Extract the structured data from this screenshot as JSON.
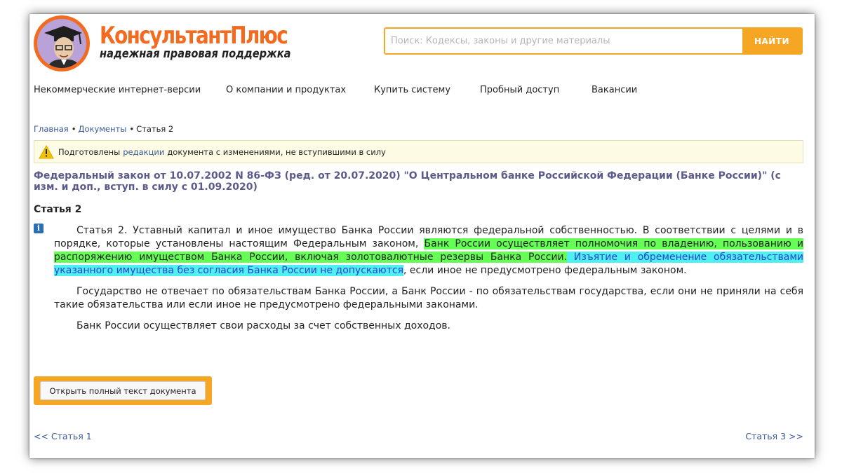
{
  "brand": {
    "wordmark": "КонсультантПлюс",
    "tagline": "надежная правовая поддержка",
    "colors": {
      "orange": "#f26b1f",
      "accent": "#f5a623",
      "link": "#3a5a9a",
      "title": "#5a5a8c"
    }
  },
  "search": {
    "placeholder": "Поиск: Кодексы, законы и другие материалы",
    "value": "",
    "button_label": "НАЙТИ"
  },
  "nav": [
    {
      "label": "Некоммерческие интернет-версии"
    },
    {
      "label": "О компании и продуктах"
    },
    {
      "label": "Купить систему"
    },
    {
      "label": "Пробный доступ"
    },
    {
      "label": "Вакансии"
    }
  ],
  "breadcrumb": {
    "home": "Главная",
    "docs": "Документы",
    "current": "Статья 2",
    "sep": "•"
  },
  "notice": {
    "icon": "warning-icon",
    "prefix": "Подготовлены",
    "link": "редакции",
    "suffix": "документа с изменениями, не вступившими в силу"
  },
  "doc_title": "Федеральный закон от 10.07.2002 N 86-ФЗ (ред. от 20.07.2020) \"О Центральном банке Российской Федерации (Банке России)\" (с изм. и доп., вступ. в силу с 01.09.2020)",
  "article": {
    "heading": "Статья 2",
    "info_icon": "i",
    "p1_part1": "Статья 2. Уставный капитал и иное имущество Банка России являются федеральной собственностью. В соответствии с целями и в порядке, которые установлены настоящим Федеральным законом, ",
    "p1_green": "Банк России осуществляет полномочия по владению, пользованию и распоряжению имуществом Банка России, включая золотовалютные резервы Банка России.",
    "p1_cyan": " Изъятие и обременение обязательствами указанного имущества без согласия Банка России не допускаются",
    "p1_part2": ", если иное не предусмотрено федеральным законом.",
    "p2": "Государство не отвечает по обязательствам Банка России, а Банк России - по обязательствам государства, если они не приняли на себя такие обязательства или если иное не предусмотрено федеральными законами.",
    "p3": "Банк России осуществляет свои расходы за счет собственных доходов."
  },
  "open_full_label": "Открыть полный текст документа",
  "pager": {
    "prev": "<< Статья 1",
    "next": "Статья 3 >>"
  }
}
